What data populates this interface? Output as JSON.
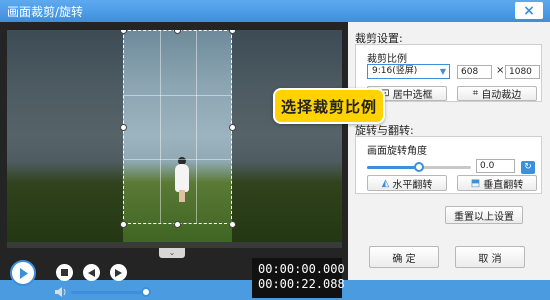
{
  "window": {
    "title": "画面裁剪/旋转",
    "close_glyph": "×"
  },
  "player": {
    "expand_glyph": "⌄",
    "time_current": "00:00:00.000",
    "time_total": "00:00:22.088",
    "volume_level": 0.92
  },
  "crop_section": {
    "title": "裁剪设置:",
    "ratio_label": "裁剪比例",
    "ratio_value": "9:16(竖屏)",
    "width": "608",
    "times": "×",
    "height": "1080",
    "center_button": "居中选框",
    "auto_crop_button": "自动裁边"
  },
  "rotate_section": {
    "title": "旋转与翻转:",
    "angle_label": "画面旋转角度",
    "angle_value": "0.0",
    "angle_fraction": 0.5,
    "flip_h_button": "水平翻转",
    "flip_v_button": "垂直翻转"
  },
  "reset_button": "重置以上设置",
  "ok_button": "确 定",
  "cancel_button": "取 消",
  "tooltip": "选择裁剪比例",
  "colors": {
    "accent": "#3d8fdc",
    "tooltip": "#ffd200"
  }
}
